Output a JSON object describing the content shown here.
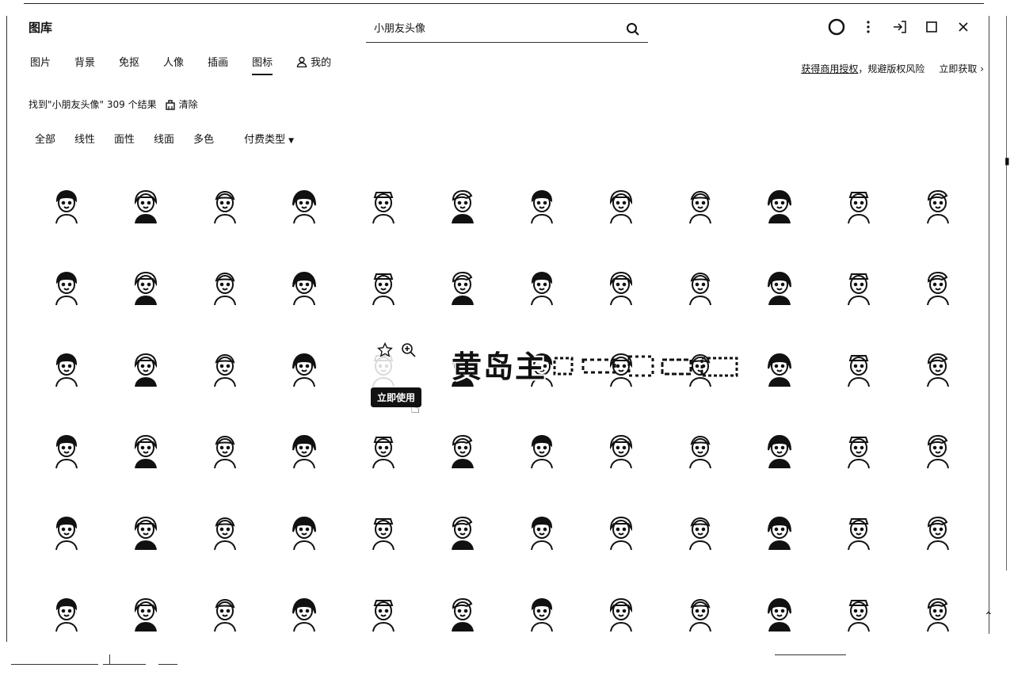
{
  "app": {
    "title": "图库"
  },
  "search": {
    "value": "小朋友头像",
    "placeholder": ""
  },
  "tabs": [
    {
      "label": "图片"
    },
    {
      "label": "背景"
    },
    {
      "label": "免抠"
    },
    {
      "label": "人像"
    },
    {
      "label": "插画"
    },
    {
      "label": "图标",
      "active": true
    },
    {
      "label": "我的",
      "icon": "user-icon"
    }
  ],
  "license": {
    "text_link": "获得商用授权",
    "text_rest": "，规避版权风险",
    "cta": "立即获取"
  },
  "results": {
    "text": "找到\"小朋友头像\" 309 个结果",
    "clear_label": "清除"
  },
  "filters": {
    "items": [
      "全部",
      "线性",
      "面性",
      "线面",
      "多色"
    ],
    "pay_type": "付费类型"
  },
  "hover": {
    "use_label": "立即使用"
  },
  "watermark": {
    "text": "黄岛主"
  },
  "colors": {
    "ink": "#111111",
    "background": "#ffffff"
  },
  "icons": [
    "kid-avatar-icon"
  ]
}
